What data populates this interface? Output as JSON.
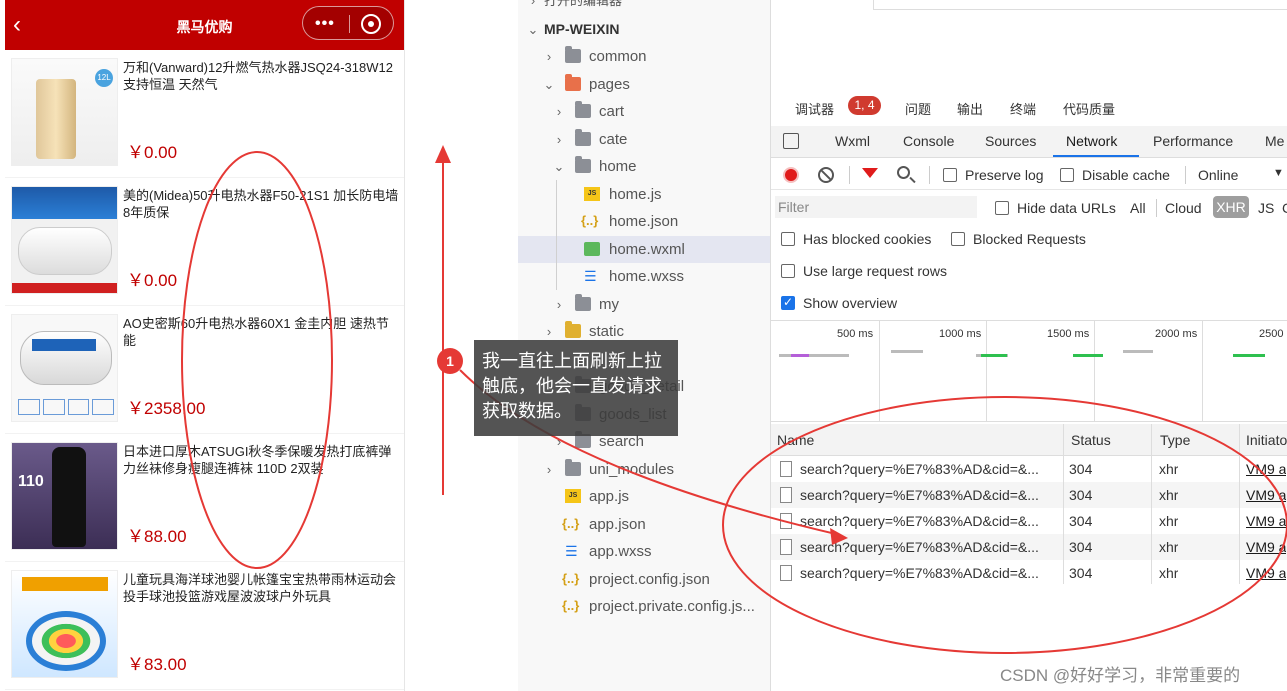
{
  "phone": {
    "title": "黑马优购",
    "back_icon": "chevron-left-icon",
    "more_icon": "more-dots-icon",
    "close_icon": "target-icon",
    "goods": [
      {
        "name": "万和(Vanward)12升燃气热水器JSQ24-318W12支持恒温 天然气",
        "price": "￥0.00"
      },
      {
        "name": "美的(Midea)50升电热水器F50-21S1 加长防电墙 8年质保",
        "price": "￥0.00"
      },
      {
        "name": "AO史密斯60升电热水器60X1 金圭内胆 速热节能",
        "price": "￥2358.00"
      },
      {
        "name": "日本进口厚木ATSUGI秋冬季保暖发热打底裤弹力丝袜修身瘦腿连裤袜 110D 2双装",
        "price": "￥88.00"
      },
      {
        "name": "儿童玩具海洋球池婴儿帐篷宝宝热带雨林运动会投手球池投篮游戏屋波波球户外玩具",
        "price": "￥83.00"
      }
    ]
  },
  "explorer": {
    "header_partial": "打开的编辑器",
    "root": "MP-WEIXIN",
    "items": [
      {
        "label": "common",
        "type": "folder"
      },
      {
        "label": "pages",
        "type": "folder-open"
      },
      {
        "label": "cart",
        "type": "folder"
      },
      {
        "label": "cate",
        "type": "folder"
      },
      {
        "label": "home",
        "type": "folder-open"
      },
      {
        "label": "home.js",
        "type": "js"
      },
      {
        "label": "home.json",
        "type": "json"
      },
      {
        "label": "home.wxml",
        "type": "wxml"
      },
      {
        "label": "home.wxss",
        "type": "wxss"
      },
      {
        "label": "my",
        "type": "folder"
      },
      {
        "label": "static",
        "type": "folder"
      },
      {
        "label": "goods_detail",
        "type": "folder"
      },
      {
        "label": "goods_list",
        "type": "folder"
      },
      {
        "label": "search",
        "type": "folder"
      },
      {
        "label": "uni_modules",
        "type": "folder"
      },
      {
        "label": "app.js",
        "type": "js"
      },
      {
        "label": "app.json",
        "type": "json"
      },
      {
        "label": "app.wxss",
        "type": "wxss"
      },
      {
        "label": "project.config.json",
        "type": "json"
      },
      {
        "label": "project.private.config.js...",
        "type": "json"
      }
    ]
  },
  "devtools": {
    "panel_tabs": [
      "调试器",
      "问题",
      "输出",
      "终端",
      "代码质量"
    ],
    "error_badge": "1, 4",
    "tabs": [
      "Wxml",
      "Console",
      "Sources",
      "Network",
      "Performance",
      "Me"
    ],
    "active_tab": "Network",
    "toolbar": {
      "preserve_log": "Preserve log",
      "disable_cache": "Disable cache",
      "throttle": "Online"
    },
    "filter": {
      "placeholder": "Filter",
      "hide_data_urls": "Hide data URLs",
      "types": [
        "All",
        "Cloud",
        "XHR",
        "JS",
        "C"
      ]
    },
    "options": {
      "blocked_cookies": "Has blocked cookies",
      "blocked_requests": "Blocked Requests",
      "large_rows": "Use large request rows",
      "show_overview": "Show overview"
    },
    "overview_ticks": [
      "500 ms",
      "1000 ms",
      "1500 ms",
      "2000 ms",
      "2500"
    ],
    "columns": [
      "Name",
      "Status",
      "Type",
      "Initiato"
    ],
    "requests": [
      {
        "name": "search?query=%E7%83%AD&cid=&...",
        "status": "304",
        "type": "xhr",
        "initiator": "VM9 a"
      },
      {
        "name": "search?query=%E7%83%AD&cid=&...",
        "status": "304",
        "type": "xhr",
        "initiator": "VM9 a"
      },
      {
        "name": "search?query=%E7%83%AD&cid=&...",
        "status": "304",
        "type": "xhr",
        "initiator": "VM9 a"
      },
      {
        "name": "search?query=%E7%83%AD&cid=&...",
        "status": "304",
        "type": "xhr",
        "initiator": "VM9 a"
      },
      {
        "name": "search?query=%E7%83%AD&cid=&...",
        "status": "304",
        "type": "xhr",
        "initiator": "VM9 a"
      }
    ]
  },
  "annotation": {
    "step": "1",
    "callout": "我一直往上面刷新上拉触底，他会一直发请求获取数据。",
    "color": "#e53935"
  },
  "watermark": "CSDN @好好学习，非常重要的"
}
